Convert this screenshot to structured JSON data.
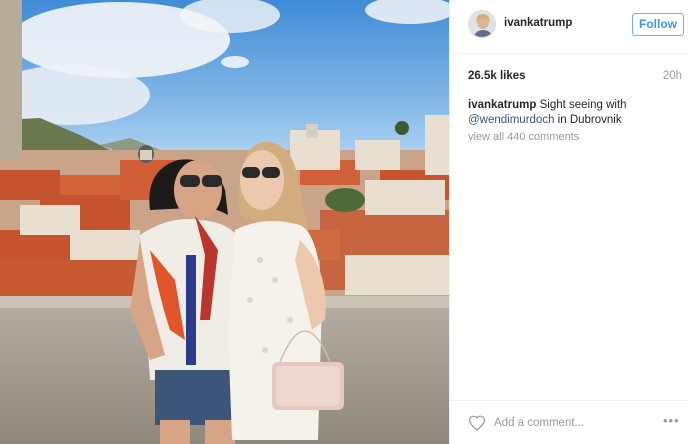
{
  "photo": {
    "alt_icon": "photo"
  },
  "header": {
    "username": "ivankatrump",
    "follow_label": "Follow",
    "avatar_icon": "avatar",
    "follow_color": "#3897f0"
  },
  "stats": {
    "likes": "26.5k likes",
    "time": "20h"
  },
  "caption": {
    "user": "ivankatrump",
    "text_before": "Sight seeing with",
    "mention": "@wendimurdoch",
    "text_after": "in Dubrovnik",
    "view_comments": "view all 440 comments"
  },
  "footer": {
    "heart_icon": "heart-icon",
    "comment_placeholder": "Add a comment...",
    "more_label": "•••"
  }
}
